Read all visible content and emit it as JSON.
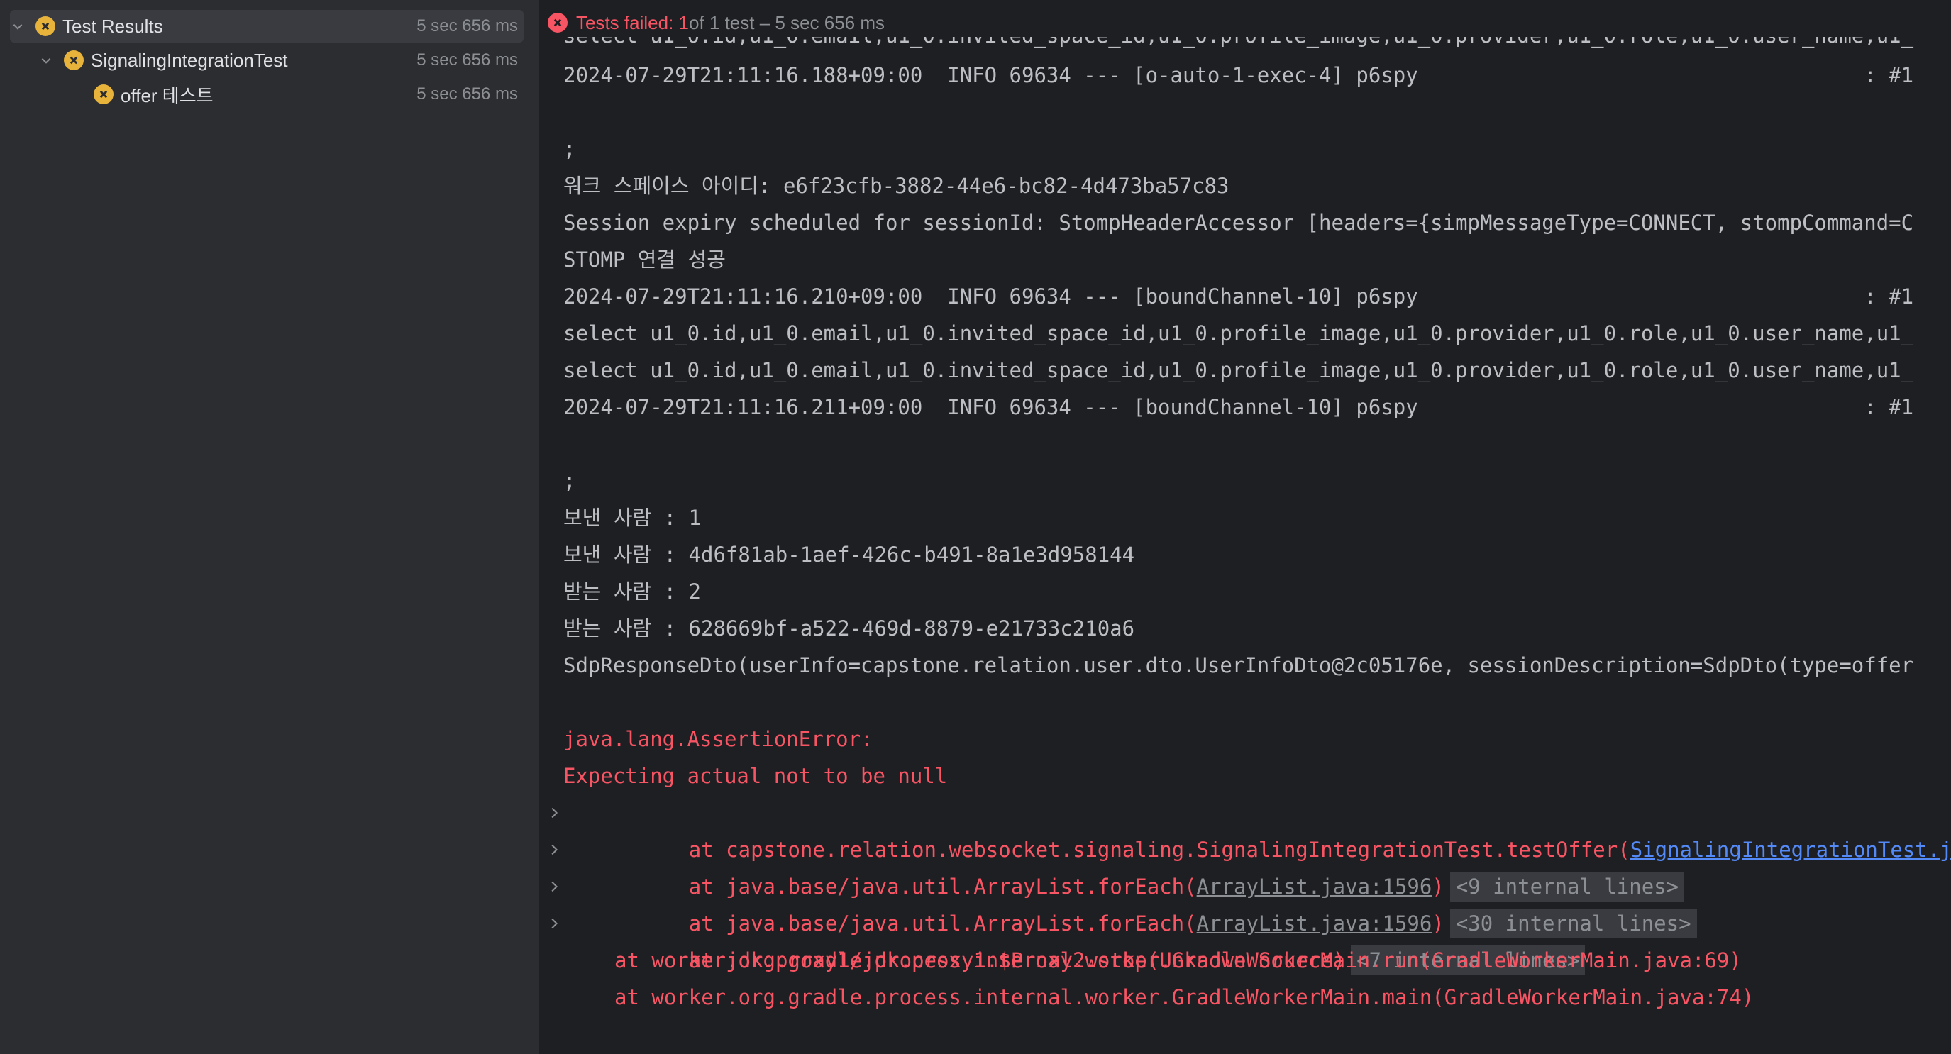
{
  "tree": {
    "items": [
      {
        "label": "Test Results",
        "time": "5 sec 656 ms"
      },
      {
        "label": "SignalingIntegrationTest",
        "time": "5 sec 656 ms"
      },
      {
        "label": "offer 테스트",
        "time": "5 sec 656 ms"
      }
    ]
  },
  "status": {
    "failed": "Tests failed: 1",
    "rest": " of 1 test – 5 sec 656 ms"
  },
  "console": {
    "lines": [
      "select u1_0.id,u1_0.email,u1_0.invited_space_id,u1_0.profile_image,u1_0.provider,u1_0.role,u1_0.user_name,u1_",
      "2024-07-29T21:11:16.188+09:00  INFO 69634 --- [o-auto-1-exec-4] p6spy                                    : #1",
      "",
      ";",
      "워크 스페이스 아이디: e6f23cfb-3882-44e6-bc82-4d473ba57c83",
      "Session expiry scheduled for sessionId: StompHeaderAccessor [headers={simpMessageType=CONNECT, stompCommand=C",
      "STOMP 연결 성공",
      "2024-07-29T21:11:16.210+09:00  INFO 69634 --- [boundChannel-10] p6spy                                    : #1",
      "select u1_0.id,u1_0.email,u1_0.invited_space_id,u1_0.profile_image,u1_0.provider,u1_0.role,u1_0.user_name,u1_",
      "select u1_0.id,u1_0.email,u1_0.invited_space_id,u1_0.profile_image,u1_0.provider,u1_0.role,u1_0.user_name,u1_",
      "2024-07-29T21:11:16.211+09:00  INFO 69634 --- [boundChannel-10] p6spy                                    : #1",
      "",
      ";",
      "보낸 사람 : 1",
      "보낸 사람 : 4d6f81ab-1aef-426c-b491-8a1e3d958144",
      "받는 사람 : 2",
      "받는 사람 : 628669bf-a522-469d-8879-e21733c210a6",
      "SdpResponseDto(userInfo=capstone.relation.user.dto.UserInfoDto@2c05176e, sessionDescription=SdpDto(type=offer",
      ""
    ],
    "error": {
      "title": "java.lang.AssertionError:",
      "message": "Expecting actual not to be null"
    },
    "stack": [
      {
        "prefix": "at capstone.relation.websocket.signaling.SignalingIntegrationTest.testOffer(",
        "file": "SignalingIntegrationTest.java",
        "suffix": "",
        "internal": ""
      },
      {
        "prefix": "at java.base/java.util.ArrayList.forEach(",
        "file": "ArrayList.java:1596",
        "suffix": ")",
        "internal": "<9 internal lines>"
      },
      {
        "prefix": "at java.base/java.util.ArrayList.forEach(",
        "file": "ArrayList.java:1596",
        "suffix": ")",
        "internal": "<30 internal lines>"
      },
      {
        "prefix": "at jdk.proxy1/jdk.proxy1.$Proxy2.stop(Unknown Source)",
        "file": "",
        "suffix": "",
        "internal": "<7 internal lines>"
      },
      {
        "prefix": "at worker.org.gradle.process.internal.worker.GradleWorkerMain.run(GradleWorkerMain.java:69)",
        "file": "",
        "suffix": "",
        "internal": ""
      },
      {
        "prefix": "at worker.org.gradle.process.internal.worker.GradleWorkerMain.main(GradleWorkerMain.java:74)",
        "file": "",
        "suffix": "",
        "internal": ""
      }
    ]
  },
  "colors": {
    "fail_badge": "#e8b33b",
    "error_text": "#f75464",
    "link": "#548af7"
  },
  "icons": {
    "tree_expand": "chevron-down-icon",
    "tree_status": "test-failed-icon",
    "stack_expand": "chevron-right-icon"
  }
}
